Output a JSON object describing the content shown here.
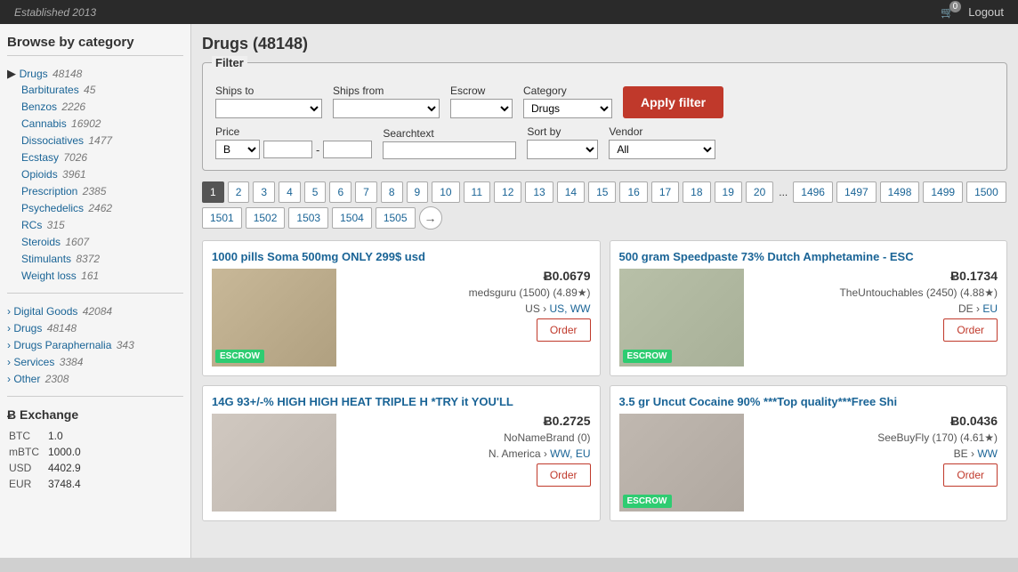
{
  "topbar": {
    "established": "Established 2013",
    "cart_count": "0",
    "logout_label": "Logout"
  },
  "sidebar": {
    "browse_title": "Browse by category",
    "drugs_label": "Drugs",
    "drugs_count": "48148",
    "subcategories": [
      {
        "name": "Barbiturates",
        "count": "45"
      },
      {
        "name": "Benzos",
        "count": "2226"
      },
      {
        "name": "Cannabis",
        "count": "16902"
      },
      {
        "name": "Dissociatives",
        "count": "1477"
      },
      {
        "name": "Ecstasy",
        "count": "7026"
      },
      {
        "name": "Opioids",
        "count": "3961"
      },
      {
        "name": "Prescription",
        "count": "2385"
      },
      {
        "name": "Psychedelics",
        "count": "2462"
      },
      {
        "name": "RCs",
        "count": "315"
      },
      {
        "name": "Steroids",
        "count": "1607"
      },
      {
        "name": "Stimulants",
        "count": "8372"
      },
      {
        "name": "Weight loss",
        "count": "161"
      }
    ],
    "other_categories": [
      {
        "name": "Digital Goods",
        "count": "42084"
      },
      {
        "name": "Drugs",
        "count": "48148"
      },
      {
        "name": "Drugs Paraphernalia",
        "count": "343"
      },
      {
        "name": "Services",
        "count": "3384"
      },
      {
        "name": "Other",
        "count": "2308"
      }
    ],
    "exchange_title": "Ƀ Exchange",
    "exchange_rates": [
      {
        "currency": "BTC",
        "rate": "1.0"
      },
      {
        "currency": "mBTC",
        "rate": "1000.0"
      },
      {
        "currency": "USD",
        "rate": "4402.9"
      },
      {
        "currency": "EUR",
        "rate": "3748.4"
      }
    ]
  },
  "content": {
    "page_title": "Drugs (48148)",
    "filter": {
      "legend": "Filter",
      "ships_to_label": "Ships to",
      "ships_from_label": "Ships from",
      "escrow_label": "Escrow",
      "category_label": "Category",
      "category_value": "Drugs",
      "price_label": "Price",
      "price_currency": "B",
      "searchtext_label": "Searchtext",
      "sort_by_label": "Sort by",
      "vendor_label": "Vendor",
      "vendor_value": "All",
      "apply_label": "Apply filter"
    },
    "pagination": {
      "pages": [
        "1",
        "2",
        "3",
        "4",
        "5",
        "6",
        "7",
        "8",
        "9",
        "10",
        "11",
        "12",
        "13",
        "14",
        "15",
        "16",
        "17",
        "18",
        "19",
        "20",
        "...",
        "1496",
        "1497",
        "1498",
        "1499",
        "1500",
        "1501",
        "1502",
        "1503",
        "1504",
        "1505"
      ],
      "active": "1"
    },
    "listings": [
      {
        "title": "1000 pills Soma 500mg ONLY 299$ usd",
        "price": "Ƀ0.0679",
        "vendor": "medsguru (1500) (4.89★)",
        "ships_from": "US",
        "ships_to": "US, WW",
        "escrow": "ESCROW",
        "order_label": "Order"
      },
      {
        "title": "500 gram Speedpaste 73% Dutch Amphetamine - ESC",
        "price": "Ƀ0.1734",
        "vendor": "TheUntouchables (2450) (4.88★)",
        "ships_from": "DE",
        "ships_to": "EU",
        "escrow": "ESCROW",
        "order_label": "Order"
      },
      {
        "title": "14G 93+/-% HIGH HIGH HEAT TRIPLE H *TRY it YOU'LL",
        "price": "Ƀ0.2725",
        "vendor": "NoNameBrand (0)",
        "ships_from": "N. America",
        "ships_to": "WW, EU",
        "escrow": "",
        "order_label": "Order"
      },
      {
        "title": "3.5 gr Uncut Cocaine 90% ***Top quality***Free Shi",
        "price": "Ƀ0.0436",
        "vendor": "SeeBuyFly (170) (4.61★)",
        "ships_from": "BE",
        "ships_to": "WW",
        "escrow": "ESCROW",
        "order_label": "Order"
      }
    ]
  }
}
